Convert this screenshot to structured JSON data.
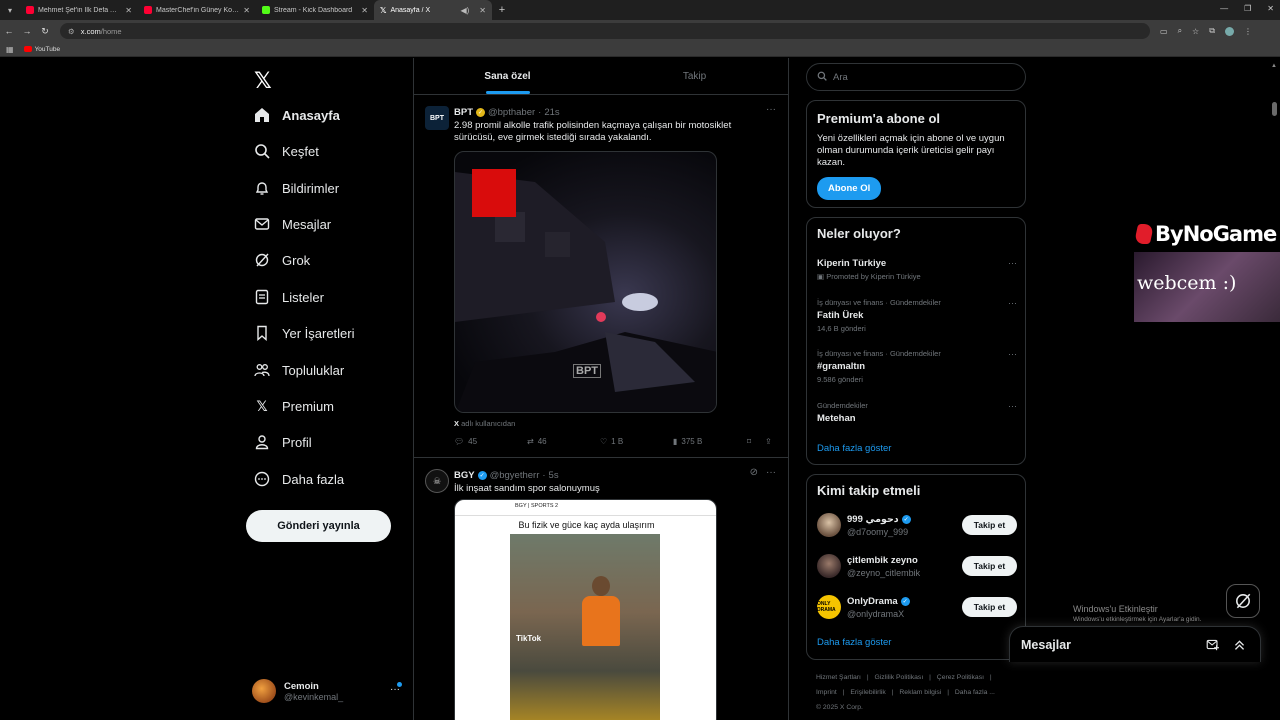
{
  "browser": {
    "tabs": [
      {
        "title": "Mehmet Şef'in İlk Defa Anlattığı",
        "favicon_color": "#ff0033",
        "active": false
      },
      {
        "title": "MasterChef'in Güney Koreli Yarış",
        "favicon_color": "#ff0033",
        "active": false
      },
      {
        "title": "Stream - Kick Dashboard",
        "favicon_color": "#53fc18",
        "active": false
      },
      {
        "title": "Anasayfa / X",
        "favicon_color": "#ffffff",
        "active": true
      }
    ],
    "url_host": "x.com",
    "url_path": "/home",
    "bookmarks": [
      {
        "label": "YouTube"
      }
    ]
  },
  "nav": {
    "items": [
      {
        "label": "Anasayfa",
        "icon": "home-icon",
        "active": true
      },
      {
        "label": "Keşfet",
        "icon": "search-icon"
      },
      {
        "label": "Bildirimler",
        "icon": "bell-icon"
      },
      {
        "label": "Mesajlar",
        "icon": "mail-icon"
      },
      {
        "label": "Grok",
        "icon": "grok-icon"
      },
      {
        "label": "Listeler",
        "icon": "list-icon"
      },
      {
        "label": "Yer İşaretleri",
        "icon": "bookmark-icon"
      },
      {
        "label": "Topluluklar",
        "icon": "community-icon"
      },
      {
        "label": "Premium",
        "icon": "x-icon"
      },
      {
        "label": "Profil",
        "icon": "person-icon"
      },
      {
        "label": "Daha fazla",
        "icon": "more-circle-icon"
      }
    ],
    "post_button": "Gönderi yayınla",
    "account": {
      "name": "Cemoin",
      "handle": "@kevinkemal_"
    }
  },
  "timeline": {
    "tabs": [
      "Sana özel",
      "Takip"
    ],
    "tweets": [
      {
        "name": "BPT",
        "handle": "@bpthaber",
        "time": "21s",
        "verified_color": "#e2b719",
        "text": "2.98 promil alkolle trafik polisinden kaçmaya çalışan bir motosiklet sürücüsü, eve girmek istediği sırada yakalandı.",
        "media_caption_prefix": "X",
        "media_caption": "adlı kullanıcıdan",
        "media_watermark": "BPT",
        "stats": {
          "replies": "45",
          "reposts": "46",
          "likes": "1 B",
          "views": "375 B"
        }
      },
      {
        "name": "BGY",
        "handle": "@bgyetherr",
        "time": "5s",
        "verified_color": "#1d9bf0",
        "text": "İlk inşaat sandım spor salonuymuş",
        "media_header": "BGY | SPORTS 2",
        "media_title": "Bu fizik ve güce kaç ayda ulaşırım",
        "media_badge": "TikTok"
      }
    ]
  },
  "sidebar": {
    "search_placeholder": "Ara",
    "premium": {
      "title": "Premium'a abone ol",
      "text": "Yeni özellikleri açmak için abone ol ve uygun olman durumunda içerik üreticisi gelir payı kazan.",
      "button": "Abone Ol"
    },
    "trends": {
      "title": "Neler oluyor?",
      "items": [
        {
          "context": "",
          "title": "Kiperin Türkiye",
          "count": "Promoted by Kiperin Türkiye"
        },
        {
          "context": "İş dünyası ve finans · Gündemdekiler",
          "title": "Fatih Ürek",
          "count": "14,6 B gönderi"
        },
        {
          "context": "İş dünyası ve finans · Gündemdekiler",
          "title": "#gramaltın",
          "count": "9.586 gönderi"
        },
        {
          "context": "Gündemdekiler",
          "title": "Metehan",
          "count": ""
        }
      ],
      "show_more": "Daha fazla göster"
    },
    "who_to_follow": {
      "title": "Kimi takip etmeli",
      "items": [
        {
          "name": "999 دحومي",
          "handle": "@d7oomy_999",
          "verified": true,
          "button": "Takip et"
        },
        {
          "name": "çitlembik zeyno",
          "handle": "@zeyno_citlembik",
          "verified": false,
          "button": "Takip et"
        },
        {
          "name": "OnlyDrama",
          "handle": "@onlydramaX",
          "verified": true,
          "button": "Takip et"
        }
      ],
      "show_more": "Daha fazla göster"
    },
    "footer": [
      "Hizmet Şartları",
      "|",
      "Gizlilik Politikası",
      "|",
      "Çerez Politikası",
      "|",
      "Imprint",
      "|",
      "Erişilebilirlik",
      "|",
      "Reklam bilgisi",
      "|",
      "Daha fazla ...",
      "© 2025 X Corp."
    ]
  },
  "overlay": {
    "brand": "ByNoGame",
    "webcam_text": "webcem :)",
    "windows_title": "Windows'u Etkinleştir",
    "windows_sub": "Windows'u etkinleştirmek için Ayarlar'a gidin."
  },
  "messages_drawer": {
    "title": "Mesajlar"
  }
}
